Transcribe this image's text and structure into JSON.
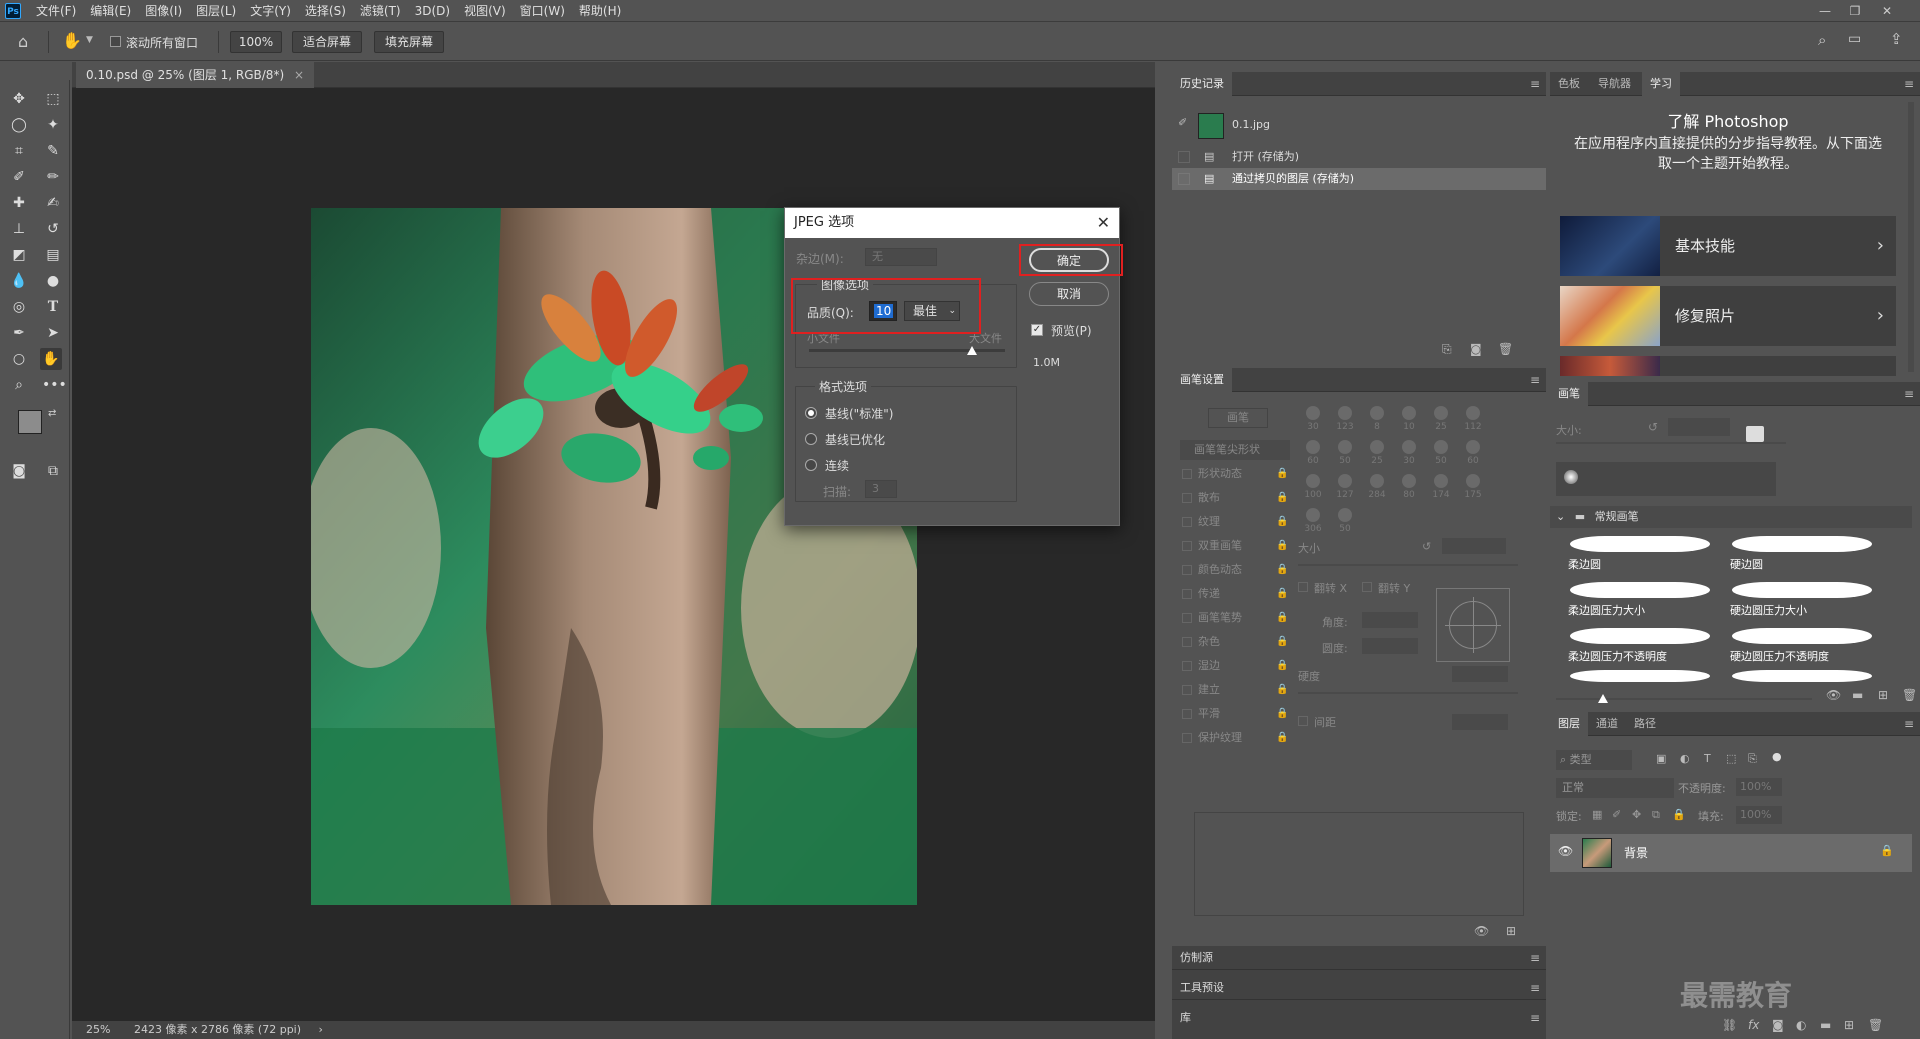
{
  "menubar": {
    "logo": "Ps",
    "items": [
      "文件(F)",
      "编辑(E)",
      "图像(I)",
      "图层(L)",
      "文字(Y)",
      "选择(S)",
      "滤镜(T)",
      "3D(D)",
      "视图(V)",
      "窗口(W)",
      "帮助(H)"
    ]
  },
  "optionsbar": {
    "scroll_all": "滚动所有窗口",
    "zoom": "100%",
    "fit_screen": "适合屏幕",
    "fill_screen": "填充屏幕"
  },
  "document": {
    "tab": "0.10.psd @ 25% (图层 1, RGB/8*)",
    "status_zoom": "25%",
    "status_info": "2423 像素 x 2786 像素 (72 ppi)"
  },
  "dialog": {
    "title": "JPEG 选项",
    "matte_label": "杂边(M):",
    "matte_value": "无",
    "image_options": "图像选项",
    "quality_label": "品质(Q):",
    "quality_value": "10",
    "quality_preset": "最佳",
    "small_file": "小文件",
    "large_file": "大文件",
    "format_options": "格式选项",
    "format_baseline": "基线(\"标准\")",
    "format_optimized": "基线已优化",
    "format_progressive": "连续",
    "scans_label": "扫描:",
    "scans_value": "3",
    "ok": "确定",
    "cancel": "取消",
    "preview": "预览(P)",
    "size": "1.0M"
  },
  "history": {
    "title": "历史记录",
    "snapshot": "0.1.jpg",
    "items": [
      "打开 (存储为)",
      "通过拷贝的图层 (存储为)"
    ]
  },
  "brush_settings": {
    "title": "画笔设置",
    "brushes_btn": "画笔",
    "tip_shape": "画笔笔尖形状",
    "options": [
      "形状动态",
      "散布",
      "纹理",
      "双重画笔",
      "颜色动态",
      "传递",
      "画笔笔势",
      "杂色",
      "湿边",
      "建立",
      "平滑",
      "保护纹理"
    ],
    "size_label": "大小",
    "flip_x": "翻转 X",
    "flip_y": "翻转 Y",
    "angle": "角度:",
    "roundness": "圆度:",
    "hardness": "硬度",
    "spacing": "间距",
    "tip_sizes": [
      "30",
      "123",
      "8",
      "10",
      "25",
      "112",
      "60",
      "50",
      "25",
      "30",
      "50",
      "60",
      "100",
      "127",
      "284",
      "80",
      "174",
      "175",
      "306",
      "50"
    ]
  },
  "collapsed_panels": [
    "仿制源",
    "工具预设",
    "库"
  ],
  "learn": {
    "tabs": [
      "色板",
      "导航器",
      "学习"
    ],
    "heading": "了解 Photoshop",
    "description": "在应用程序内直接提供的分步指导教程。从下面选取一个主题开始教程。",
    "cards": [
      "基本技能",
      "修复照片"
    ]
  },
  "brushes": {
    "title": "画笔",
    "size_label": "大小:",
    "group": "常规画笔",
    "items": [
      "柔边圆",
      "硬边圆",
      "柔边圆压力大小",
      "硬边圆压力大小",
      "柔边圆压力不透明度",
      "硬边圆压力不透明度"
    ]
  },
  "layers": {
    "tabs": [
      "图层",
      "通道",
      "路径"
    ],
    "filter": "类型",
    "blend": "正常",
    "opacity_label": "不透明度:",
    "opacity": "100%",
    "lock_label": "锁定:",
    "fill_label": "填充:",
    "fill": "100%",
    "layer_name": "背景"
  },
  "watermark": "最需教育"
}
